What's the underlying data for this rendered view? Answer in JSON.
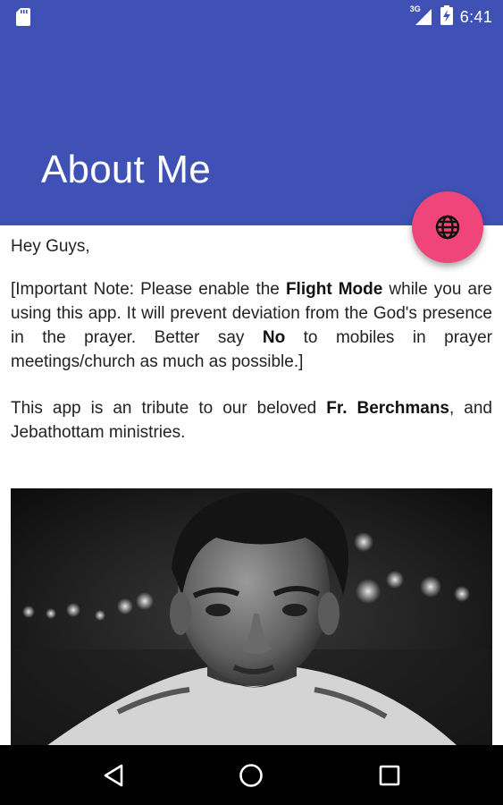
{
  "status_bar": {
    "network_label": "3G",
    "time": "6:41",
    "icons": [
      "sd-card-icon",
      "signal-icon",
      "battery-icon"
    ]
  },
  "app_bar": {
    "title": "About Me",
    "color": "#3f51b5"
  },
  "fab": {
    "icon": "globe-icon",
    "color": "#f0457a"
  },
  "content": {
    "greeting": "Hey Guys,",
    "note": {
      "t1": "[Important Note: Please enable the ",
      "b1": "Flight Mode",
      "t2": " while you are using this app. It will prevent deviation from the God's presence in the prayer. Better say ",
      "b2": "No",
      "t3": " to mobiles in prayer meetings/church as much as possible.]"
    },
    "tribute": {
      "t1": "This app is an tribute to our beloved ",
      "b1": "Fr. Berchmans",
      "t2": ", and Jebathottam ministries."
    },
    "photo": "black-and-white portrait photo"
  },
  "nav_bar": {
    "icons": [
      "back-icon",
      "home-icon",
      "recents-icon"
    ]
  }
}
